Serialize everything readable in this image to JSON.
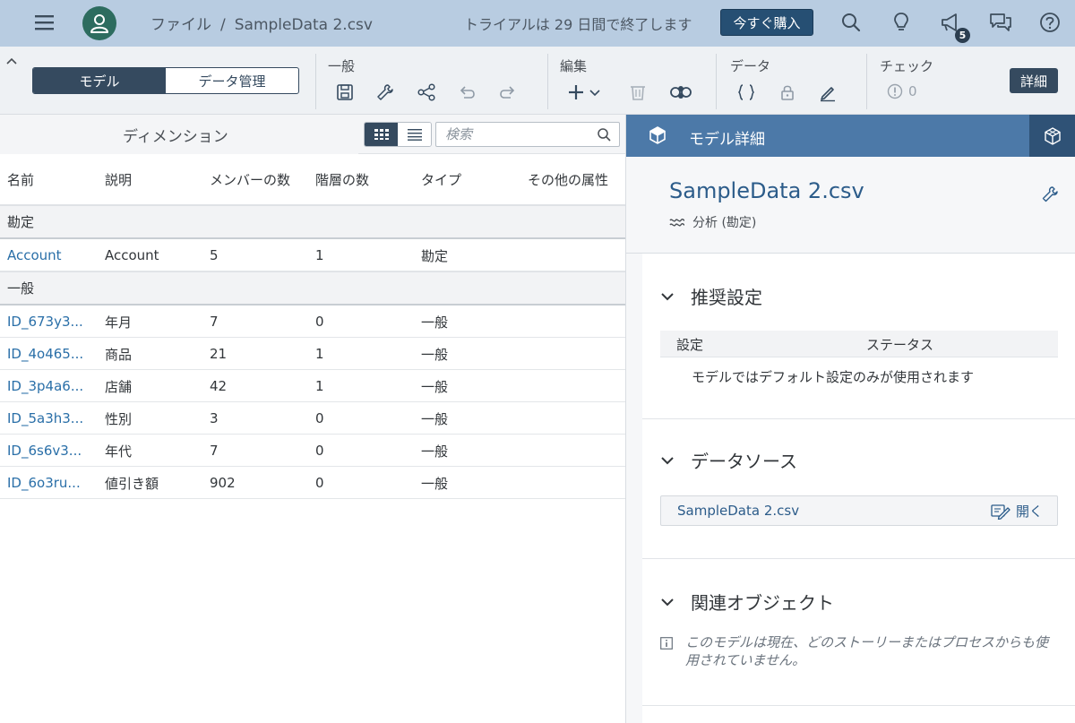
{
  "shell": {
    "breadcrumb_root": "ファイル",
    "breadcrumb_sep": "/",
    "breadcrumb_file": "SampleData 2.csv",
    "trial_text": "トライアルは 29 日間で終了します",
    "buy_label": "今すぐ購入",
    "notification_count": "5",
    "avatar_color": "#2d6c5f"
  },
  "toolbar": {
    "tab_model": "モデル",
    "tab_data_mgmt": "データ管理",
    "group_general": "一般",
    "group_edit": "編集",
    "group_data": "データ",
    "group_check": "チェック",
    "check_count": "0",
    "detail_label": "詳細"
  },
  "left": {
    "title": "ディメンション",
    "search_placeholder": "検索",
    "columns": {
      "name": "名前",
      "desc": "説明",
      "members": "メンバーの数",
      "levels": "階層の数",
      "type": "タイプ",
      "other": "その他の属性"
    },
    "group_account": "勘定",
    "group_general": "一般",
    "rows": [
      {
        "name": "Account",
        "desc": "Account",
        "members": "5",
        "levels": "1",
        "type": "勘定"
      },
      {
        "name": "ID_673y3...",
        "desc": "年月",
        "members": "7",
        "levels": "0",
        "type": "一般"
      },
      {
        "name": "ID_4o465...",
        "desc": "商品",
        "members": "21",
        "levels": "1",
        "type": "一般"
      },
      {
        "name": "ID_3p4a6...",
        "desc": "店舗",
        "members": "42",
        "levels": "1",
        "type": "一般"
      },
      {
        "name": "ID_5a3h3...",
        "desc": "性別",
        "members": "3",
        "levels": "0",
        "type": "一般"
      },
      {
        "name": "ID_6s6v3...",
        "desc": "年代",
        "members": "7",
        "levels": "0",
        "type": "一般"
      },
      {
        "name": "ID_6o3ru...",
        "desc": "値引き額",
        "members": "902",
        "levels": "0",
        "type": "一般"
      }
    ]
  },
  "right": {
    "header_title": "モデル詳細",
    "model_name": "SampleData 2.csv",
    "model_type": "分析 (勘定)",
    "sec_recommend": "推奨設定",
    "col_setting": "設定",
    "col_status": "ステータス",
    "recommend_text": "モデルではデフォルト設定のみが使用されます",
    "sec_datasource": "データソース",
    "datasource_file": "SampleData 2.csv",
    "open_label": "開く",
    "sec_related": "関連オブジェクト",
    "related_text": "このモデルは現在、どのストーリーまたはプロセスからも使用されていません。"
  }
}
